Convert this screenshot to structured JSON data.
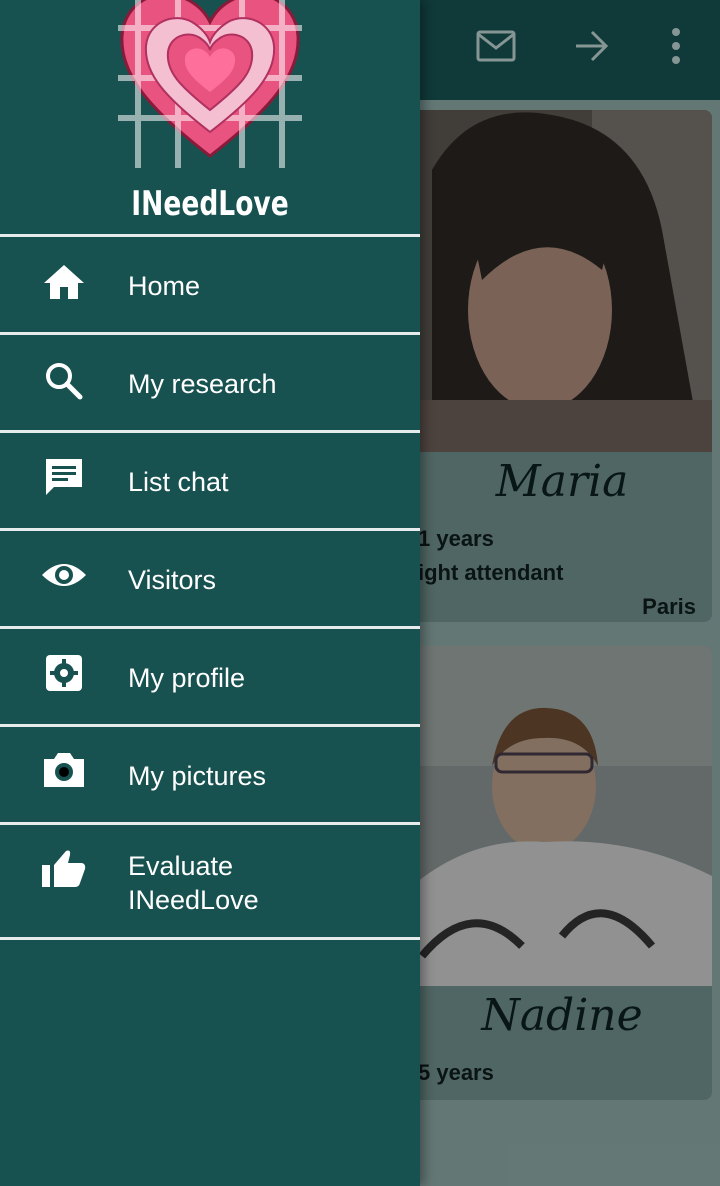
{
  "app": {
    "name": "INeedLove"
  },
  "toolbar": {
    "icons": [
      "mail-icon",
      "arrow-forward-icon",
      "more-vert-icon"
    ]
  },
  "menu": {
    "items": [
      {
        "label": "Home",
        "icon": "home-icon"
      },
      {
        "label": "My research",
        "icon": "search-icon"
      },
      {
        "label": "List chat",
        "icon": "chat-icon"
      },
      {
        "label": "Visitors",
        "icon": "eye-icon"
      },
      {
        "label": "My profile",
        "icon": "settings-icon"
      },
      {
        "label": "My pictures",
        "icon": "camera-icon"
      },
      {
        "label": "Evaluate\nINeedLove",
        "icon": "thumb-up-icon"
      }
    ]
  },
  "profiles": [
    {
      "name": "Maria",
      "age": "1 years",
      "job": "ight attendant",
      "city": "Paris"
    },
    {
      "name": "Nadine",
      "age": "5 years",
      "job": "",
      "city": ""
    }
  ],
  "colors": {
    "drawer": "#175250",
    "appbar": "#17504f",
    "text": "#ffffff"
  }
}
